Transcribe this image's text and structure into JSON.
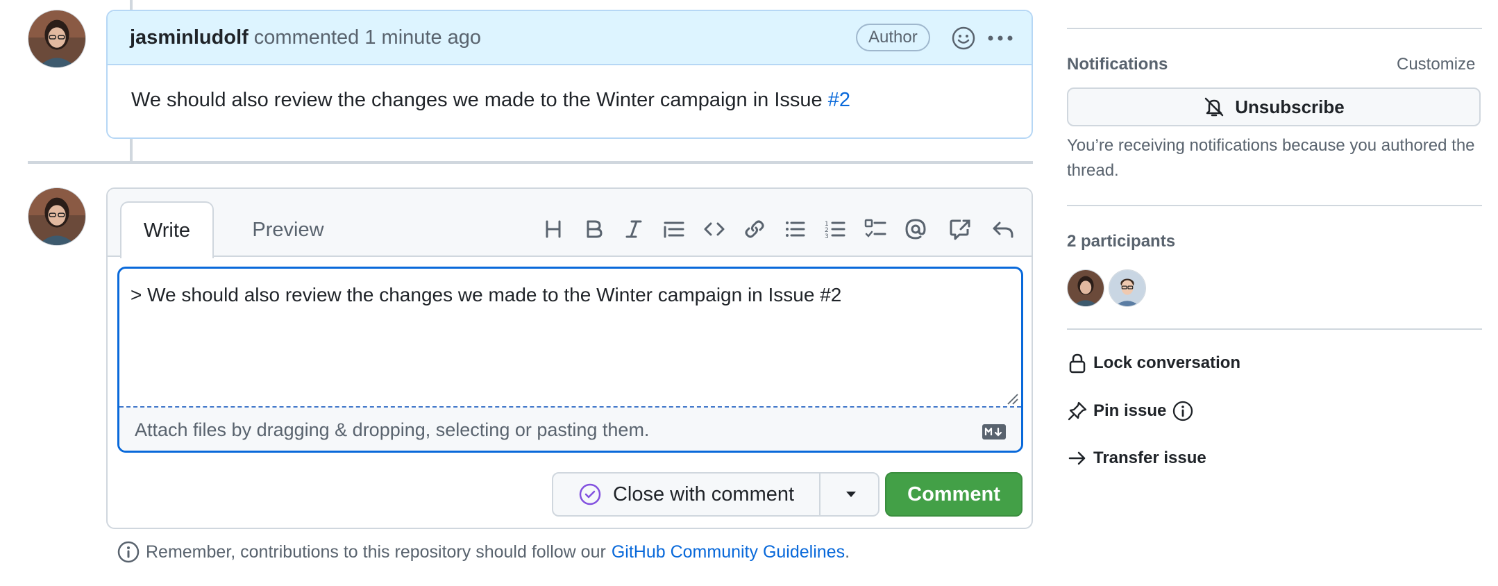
{
  "comment": {
    "author": "jasminludolf",
    "meta": "commented 1 minute ago",
    "badge": "Author",
    "body_text": "We should also review the changes we made to the Winter campaign in Issue ",
    "body_link": "#2"
  },
  "editor": {
    "tabs": [
      {
        "label": "Write"
      },
      {
        "label": "Preview"
      }
    ],
    "toolbar": [
      "heading-icon",
      "bold-icon",
      "italic-icon",
      "quote-icon",
      "code-icon",
      "link-icon",
      "bulleted-list-icon",
      "numbered-list-icon",
      "task-list-icon",
      "mention-icon",
      "cross-reference-icon",
      "reply-icon"
    ],
    "text": "> We should also review the changes we made to the Winter campaign in Issue #2",
    "attach_text": "Attach files by dragging & dropping, selecting or pasting them.",
    "close_label": "Close with comment",
    "comment_label": "Comment"
  },
  "guidelines": {
    "text": "Remember, contributions to this repository should follow our",
    "link": "GitHub Community Guidelines",
    "end": "."
  },
  "sidebar": {
    "notifications_heading": "Notifications",
    "customize": "Customize",
    "unsubscribe_label": "Unsubscribe",
    "notice": "You’re receiving notifications because you authored the thread.",
    "participants_heading": "2 participants",
    "actions": {
      "lock": "Lock conversation",
      "pin": "Pin issue",
      "transfer": "Transfer issue"
    }
  },
  "colors": {
    "accent": "#0969da",
    "header_bg": "#ddf4ff",
    "comment_green": "#43a047",
    "close_purple": "#8250df"
  }
}
